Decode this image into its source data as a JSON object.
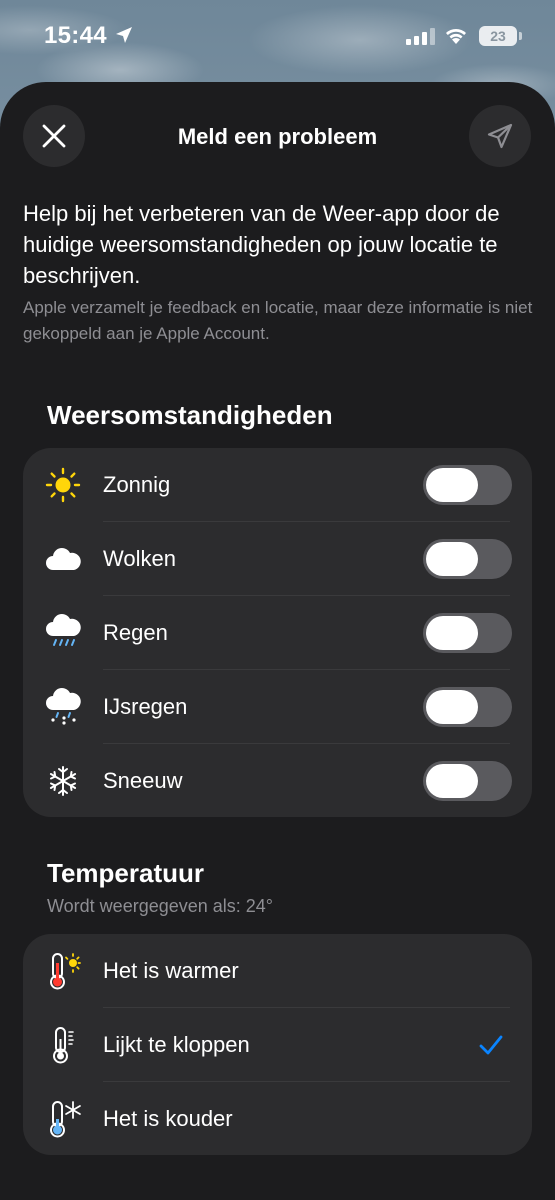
{
  "status_bar": {
    "time": "15:44",
    "battery": "23",
    "icons": [
      "location-arrow-icon",
      "signal-icon",
      "wifi-icon",
      "battery-icon"
    ]
  },
  "sheet": {
    "title": "Meld een probleem",
    "close_icon": "close-icon",
    "send_icon": "send-icon",
    "intro": "Help bij het verbeteren van de Weer-app door de huidige weersomstandigheden op jouw locatie te beschrijven.",
    "note": "Apple verzamelt je feedback en locatie, maar deze informatie is niet gekoppeld aan je Apple Account."
  },
  "conditions": {
    "title": "Weersomstandigheden",
    "items": [
      {
        "label": "Zonnig",
        "icon": "sun-icon",
        "on": false
      },
      {
        "label": "Wolken",
        "icon": "cloud-icon",
        "on": false
      },
      {
        "label": "Regen",
        "icon": "rain-icon",
        "on": false
      },
      {
        "label": "IJsregen",
        "icon": "sleet-icon",
        "on": false
      },
      {
        "label": "Sneeuw",
        "icon": "snowflake-icon",
        "on": false
      }
    ]
  },
  "temperature": {
    "title": "Temperatuur",
    "subtitle": "Wordt weergegeven als: 24°",
    "items": [
      {
        "label": "Het is warmer",
        "icon": "thermometer-sun-icon",
        "selected": false
      },
      {
        "label": "Lijkt te kloppen",
        "icon": "thermometer-icon",
        "selected": true
      },
      {
        "label": "Het is kouder",
        "icon": "thermometer-snow-icon",
        "selected": false
      }
    ]
  },
  "colors": {
    "sheet_bg": "#1c1c1e",
    "group_bg": "#2c2c2e",
    "accent": "#0a84ff",
    "secondary_text": "#8e8e93",
    "sun": "#ffd60a",
    "thermo_red": "#ff3b30",
    "thermo_blue": "#64b5f6"
  }
}
